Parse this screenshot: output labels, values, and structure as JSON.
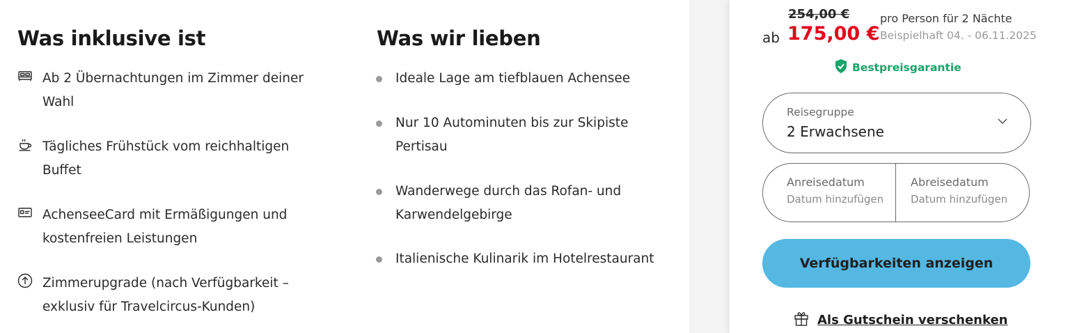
{
  "inclusions": {
    "title": "Was inklusive ist",
    "items": [
      {
        "icon": "bed-icon",
        "text": "Ab 2 Übernachtungen im Zimmer deiner Wahl"
      },
      {
        "icon": "coffee-cup-icon",
        "text": "Tägliches Frühstück vom reichhaltigen Buffet"
      },
      {
        "icon": "card-icon",
        "text": "AchenseeCard mit Ermäßigungen und kostenfreien Leistungen"
      },
      {
        "icon": "arrow-up-circle-icon",
        "text": "Zimmerupgrade (nach Verfügbarkeit – exklusiv für Travelcircus-Kunden)"
      }
    ]
  },
  "highlights": {
    "title": "Was wir lieben",
    "items": [
      "Ideale Lage am tiefblauen Achensee",
      "Nur 10 Autominuten bis zur Skipiste Pertisau",
      "Wanderwege durch das Rofan- und Karwendelgebirge",
      "Italienische Kulinarik im Hotelrestaurant"
    ]
  },
  "booking": {
    "old_price": "254,00 €",
    "prefix": "ab",
    "price": "175,00 €",
    "per_person": "pro Person für 2 Nächte",
    "example": "Beispielhaft 04. - 06.11.2025",
    "guarantee": "Bestpreisgarantie",
    "group_label": "Reisegruppe",
    "group_value": "2 Erwachsene",
    "arrival_label": "Anreisedatum",
    "arrival_placeholder": "Datum hinzufügen",
    "departure_label": "Abreisedatum",
    "departure_placeholder": "Datum hinzufügen",
    "cta": "Verfügbarkeiten anzeigen",
    "gift": "Als Gutschein verschenken"
  },
  "colors": {
    "price_red": "#e3001b",
    "guarantee_green": "#1aa36a",
    "cta_blue": "#54b8e3"
  }
}
